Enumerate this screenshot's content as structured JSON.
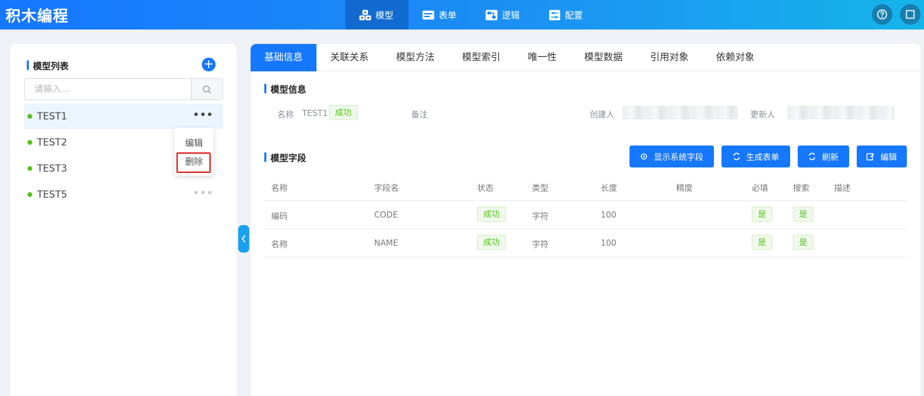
{
  "app": {
    "title": "积木编程"
  },
  "nav": [
    {
      "label": "模型",
      "icon": "cubes-icon",
      "active": true
    },
    {
      "label": "表单",
      "icon": "form-icon",
      "active": false
    },
    {
      "label": "逻辑",
      "icon": "logic-icon",
      "active": false
    },
    {
      "label": "配置",
      "icon": "settings-icon",
      "active": false
    }
  ],
  "header_icons": [
    "help-icon",
    "fullscreen-icon"
  ],
  "sidebar": {
    "title": "模型列表",
    "add_icon": "plus-icon",
    "search_placeholder": "请输入...",
    "search_icon": "search-icon",
    "items": [
      {
        "label": "TEST1",
        "status_color": "#52c41a"
      },
      {
        "label": "TEST2",
        "status_color": "#52c41a"
      },
      {
        "label": "TEST3",
        "status_color": "#52c41a"
      },
      {
        "label": "TEST5",
        "status_color": "#52c41a"
      }
    ],
    "more_icon": "•••",
    "context_menu": {
      "edit": "编辑",
      "delete": "删除"
    }
  },
  "tabs": [
    "基础信息",
    "关联关系",
    "模型方法",
    "模型索引",
    "唯一性",
    "模型数据",
    "引用对象",
    "依赖对象"
  ],
  "model_info": {
    "title": "模型信息",
    "name_label": "名称",
    "name_value": "TEST1",
    "status": "成功",
    "remark_label": "备注",
    "creator_label": "创建人",
    "updater_label": "更新人"
  },
  "fields": {
    "title": "模型字段",
    "buttons": {
      "show_system": "显示系统字段",
      "gen_form": "生成表单",
      "refresh": "刷新",
      "edit": "编辑"
    },
    "columns": [
      "名称",
      "字段名",
      "状态",
      "类型",
      "长度",
      "精度",
      "必填",
      "搜索",
      "描述"
    ],
    "rows": [
      {
        "name": "编码",
        "field": "CODE",
        "status": "成功",
        "type": "字符",
        "length": "100",
        "precision": "",
        "required": "是",
        "search": "是",
        "desc": ""
      },
      {
        "name": "名称",
        "field": "NAME",
        "status": "成功",
        "type": "字符",
        "length": "100",
        "precision": "",
        "required": "是",
        "search": "是",
        "desc": ""
      }
    ]
  },
  "colors": {
    "primary": "#1677ff",
    "success": "#52c41a",
    "danger": "#e02020"
  }
}
